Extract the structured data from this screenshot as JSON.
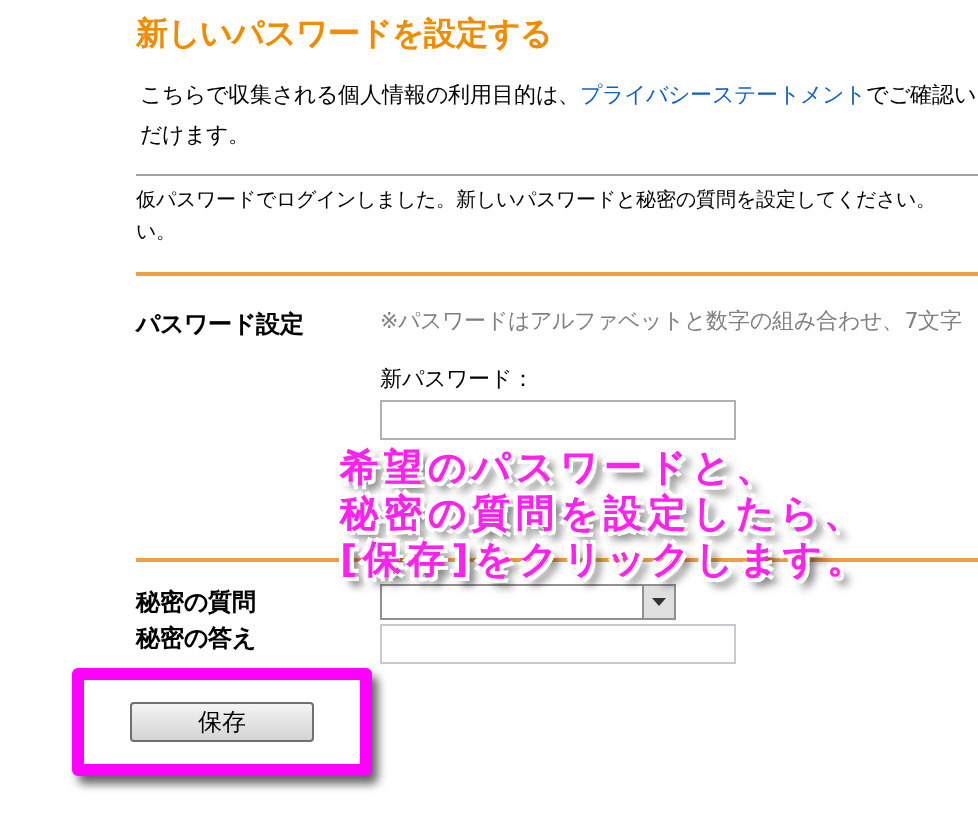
{
  "title": "新しいパスワードを設定する",
  "privacy": {
    "before": "こちらで収集される個人情報の利用目的は、",
    "link": "プライバシーステートメント",
    "after": "でご確認い",
    "line2": "だけます。"
  },
  "notice": {
    "line1": "仮パスワードでログインしました。新しいパスワードと秘密の質問を設定してください。",
    "line2": "い。"
  },
  "password_section": {
    "heading": "パスワード設定",
    "note": "※パスワードはアルファベットと数字の組み合わせ、7文字",
    "new_password_label": "新パスワード："
  },
  "secret_section": {
    "question_label": "秘密の質問",
    "answer_label": "秘密の答え"
  },
  "save_button": "保存",
  "callout": {
    "lines": [
      "希望のパスワードと、",
      "秘密の質問を設定したら、",
      "[保存]をクリックします。"
    ]
  }
}
